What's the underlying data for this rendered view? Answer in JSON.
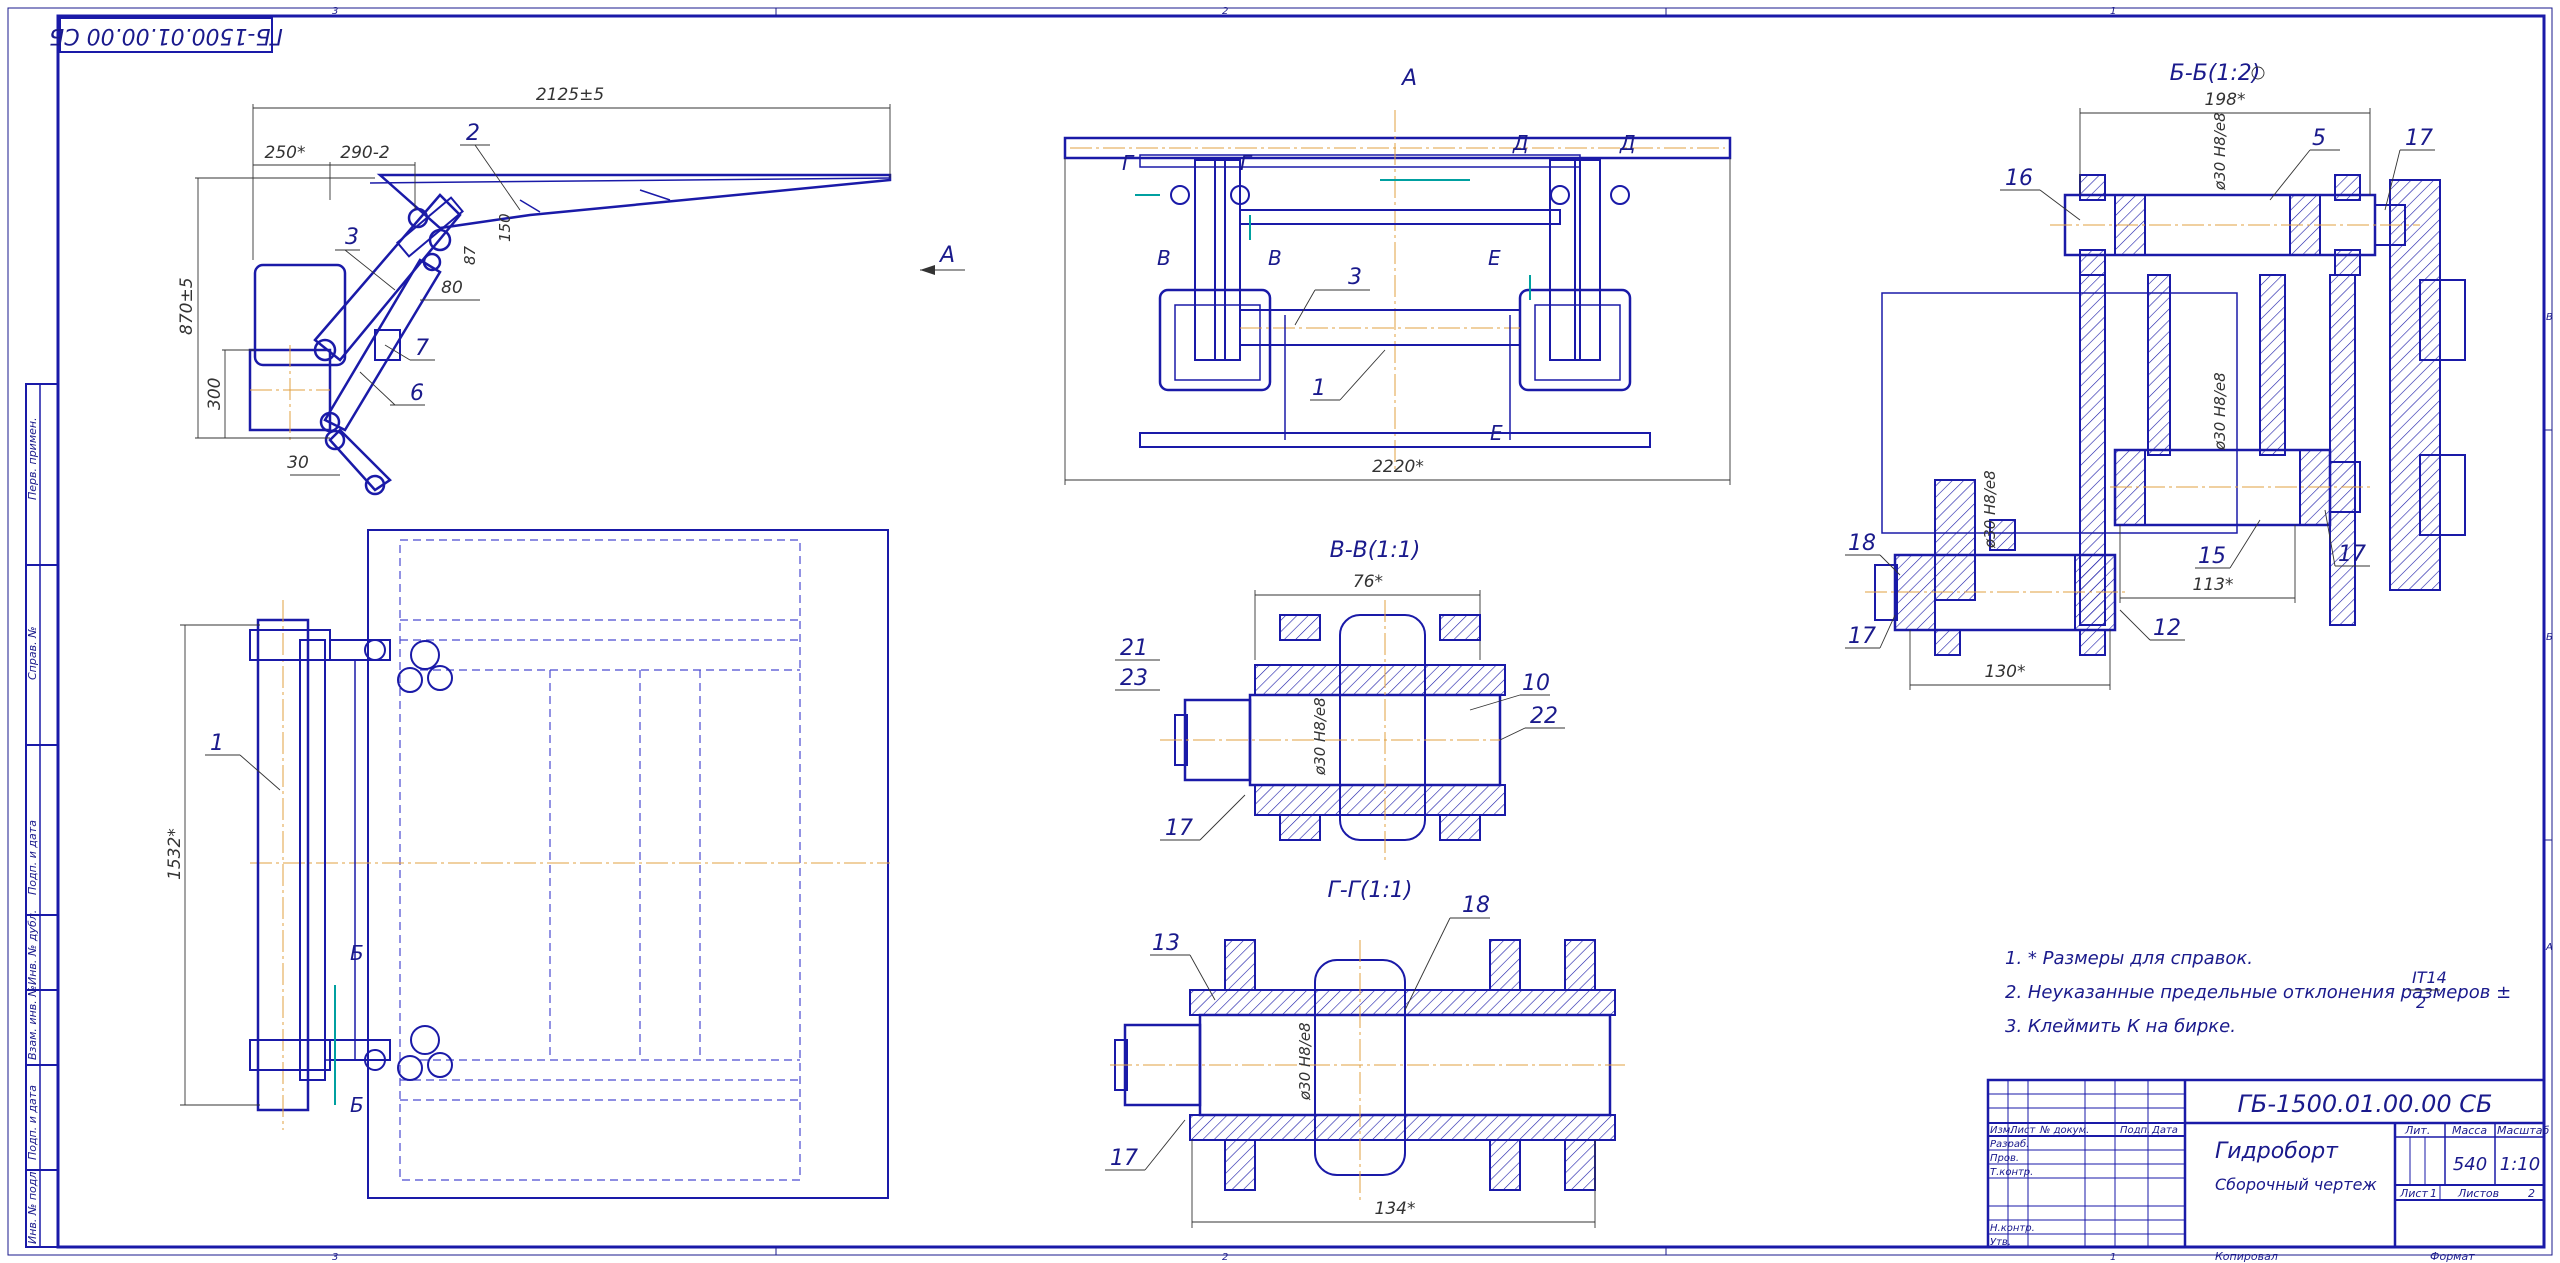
{
  "stamp_code": "ГБ-1500.01.00.00 СБ",
  "zones_top": [
    "3",
    "2",
    "1"
  ],
  "zones_bottom": [
    "3",
    "2",
    "1"
  ],
  "zones_right": [
    "В",
    "Б",
    "А"
  ],
  "left_strip": [
    "Перв. примен.",
    "Справ. №",
    "Подп. и дата",
    "Инв. № дубл.",
    "Взам. инв. №",
    "Подп. и дата",
    "Инв. № подл."
  ],
  "side_view": {
    "dims": [
      "2125±5",
      "250*",
      "290-2",
      "870±5",
      "300",
      "80",
      "87",
      "150",
      "30"
    ],
    "labels": [
      "2",
      "3",
      "7",
      "6"
    ],
    "arrow_label": "А"
  },
  "top_view": {
    "dims": [
      "1532*"
    ],
    "labels": [
      "1",
      "Б",
      "Б"
    ]
  },
  "view_a": {
    "title": "А",
    "dims": [
      "2220*"
    ],
    "labels": [
      "Г",
      "Г",
      "Д",
      "Д",
      "В",
      "В",
      "Е",
      "Е",
      "3",
      "1"
    ]
  },
  "section_vv": {
    "title": "В-В(1:1)",
    "dims": [
      "76*"
    ],
    "fit": "ø30 H8/e8",
    "labels": [
      "21",
      "23",
      "10",
      "22",
      "17"
    ]
  },
  "section_gg": {
    "title": "Г-Г(1:1)",
    "dims": [
      "134*"
    ],
    "fit": "ø30 H8/e8",
    "labels": [
      "13",
      "18",
      "17"
    ]
  },
  "section_bb": {
    "title": "Б-Б(1:2)",
    "dims": [
      "198*",
      "113*",
      "130*"
    ],
    "fit": "ø30 H8/e8",
    "labels": [
      "16",
      "5",
      "17",
      "18",
      "17",
      "15",
      "17",
      "12"
    ]
  },
  "notes": [
    "1. * Размеры для справок.",
    "2. Неуказанные предельные отклонения размеров ±",
    "3. Клеймить К на бирке."
  ],
  "note_fraction": {
    "num": "IT14",
    "den": "2"
  },
  "title_block": {
    "code": "ГБ-1500.01.00.00 СБ",
    "name": "Гидроборт",
    "doc_type": "Сборочный чертеж",
    "col_headers": [
      "Изм.",
      "Лист",
      "№ докум.",
      "Подп.",
      "Дата"
    ],
    "roles": [
      "Разраб.",
      "Пров.",
      "Т.контр.",
      "Н.контр.",
      "Утв."
    ],
    "lit_label": "Лит.",
    "mass_label": "Масса",
    "scale_label": "Масштаб",
    "mass": "540",
    "scale": "1:10",
    "sheet_label": "Лист",
    "sheet": "1",
    "sheets_label": "Листов",
    "sheets": "2",
    "copied": "Копировал",
    "format": "Формат"
  },
  "colors": {
    "line": "#1a1aa8",
    "axis": "#e0a040",
    "dim": "#333333",
    "accent": "#00a0a0"
  }
}
